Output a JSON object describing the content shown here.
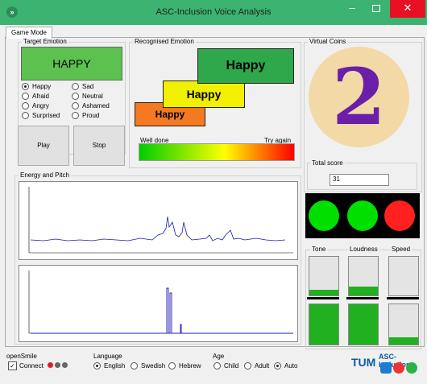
{
  "window": {
    "title": "ASC-Inclusion Voice Analysis",
    "icon": "app-logo-icon"
  },
  "tab": {
    "label": "Game Mode"
  },
  "target": {
    "label": "Target Emotion",
    "emotion": "HAPPY",
    "options": [
      "Happy",
      "Sad",
      "Afraid",
      "Neutral",
      "Angry",
      "Ashamed",
      "Surprised",
      "Proud"
    ],
    "selected": "Happy"
  },
  "buttons": {
    "play": "Play",
    "stop": "Stop"
  },
  "recognised": {
    "label": "Recognised Emotion",
    "steps": [
      {
        "text": "Happy",
        "color": "#f47920"
      },
      {
        "text": "Happy",
        "color": "#f0f000"
      },
      {
        "text": "Happy",
        "color": "#2ea84a"
      }
    ],
    "well_done": "Well done",
    "try_again": "Try again"
  },
  "energy": {
    "label": "Energy and Pitch"
  },
  "coins": {
    "label": "Virtual Coins",
    "value": "2"
  },
  "score": {
    "label": "Total score",
    "value": "31"
  },
  "lights": {
    "colors": [
      "#00e000",
      "#00e000",
      "#ff2020"
    ]
  },
  "meters": {
    "labels": [
      "Tone",
      "Loudness",
      "Speed"
    ],
    "top_levels": [
      0.15,
      0.23,
      0.0
    ],
    "bottom_levels": [
      1.0,
      1.0,
      0.18
    ]
  },
  "opensmile": {
    "label": "openSmile",
    "connect": "Connect"
  },
  "language": {
    "label": "Language",
    "options": [
      "English",
      "Swedish",
      "Hebrew"
    ],
    "selected": "English"
  },
  "age": {
    "label": "Age",
    "options": [
      "Child",
      "Adult",
      "Auto"
    ],
    "selected": "Auto"
  },
  "logo": {
    "tum": "TUM",
    "brand": "ASC-Inclusion"
  }
}
